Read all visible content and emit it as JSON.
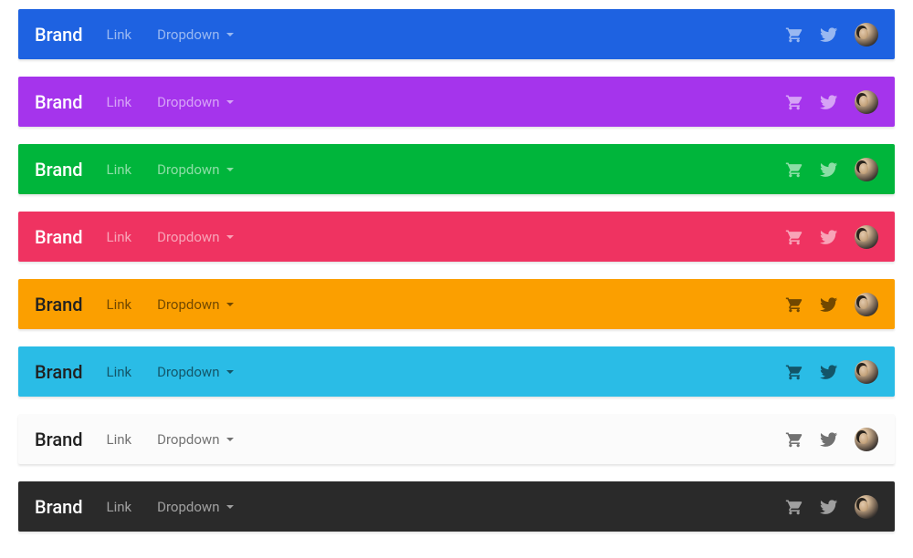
{
  "nav": {
    "brand_label": "Brand",
    "link_label": "Link",
    "dropdown_label": "Dropdown"
  },
  "icons": {
    "cart": "shopping-cart-icon",
    "twitter": "twitter-icon",
    "avatar": "avatar-icon"
  },
  "variants": [
    {
      "name": "primary",
      "bg": "#1e62e1",
      "text_mode": "light-on-dark"
    },
    {
      "name": "purple",
      "bg": "#a534ec",
      "text_mode": "light-on-dark"
    },
    {
      "name": "success",
      "bg": "#00b53b",
      "text_mode": "light-on-dark"
    },
    {
      "name": "danger",
      "bg": "#ef3361",
      "text_mode": "light-on-dark"
    },
    {
      "name": "warning",
      "bg": "#fb9f00",
      "text_mode": "dark-on-light"
    },
    {
      "name": "info",
      "bg": "#2abce6",
      "text_mode": "dark-on-light"
    },
    {
      "name": "light",
      "bg": "#fbfbfb",
      "text_mode": "dark-on-light"
    },
    {
      "name": "dark",
      "bg": "#2a2a2a",
      "text_mode": "light-on-dark"
    }
  ]
}
